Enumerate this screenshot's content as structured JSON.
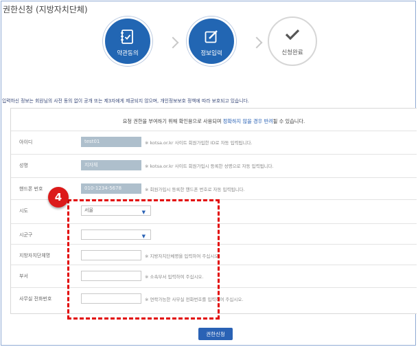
{
  "page": {
    "title": "권한신청 (지방자치단체)",
    "notice": "입력하신 정보는 회원님의 사전 동의 없이 공개 또는 제3자에게 제공되지 않으며, 개인정보보호 정책에 따라 보호되고 있습니다."
  },
  "steps": [
    {
      "label": "약관동의",
      "icon": "document-check-icon",
      "state": "active"
    },
    {
      "label": "정보입력",
      "icon": "edit-icon",
      "state": "active"
    },
    {
      "label": "신청완료",
      "icon": "check-icon",
      "state": "inactive"
    }
  ],
  "form": {
    "header": {
      "prefix": "요청 권한을 부여하기 위해 확인용으로 사용되며 ",
      "warning": "정확하지 않을 경우 반려",
      "suffix": "될 수 있습니다."
    },
    "id": {
      "label": "아이디",
      "value": "test01",
      "hint": "※ kotsa.or.kr 사이트 회원가입한 ID로 자동 입력됩니다."
    },
    "name": {
      "label": "성명",
      "value": "지자체",
      "hint": "※ kotsa.or.kr 사이트 회원가입시 등록한 성명으로 자동 입력됩니다."
    },
    "phone": {
      "label": "핸드폰 번호",
      "value": "010-1234-5678",
      "hint": "※ 회원가입시 등록한 핸드폰 번호로 자동 입력됩니다."
    },
    "sido": {
      "label": "시도",
      "value": "서울"
    },
    "sigungu": {
      "label": "시군구",
      "value": ""
    },
    "org": {
      "label": "지방자치단체명",
      "value": "",
      "hint": "※ 지방자치단체명을 입력하여 주십시오."
    },
    "dept": {
      "label": "부서",
      "value": "",
      "hint": "※ 소속부서 입력하여 주십시오."
    },
    "office_phone": {
      "label": "사무실 전화번호",
      "value": "",
      "hint": "※ 연락가능한 사무실 전화번호를 입력하여 주십시오."
    }
  },
  "annotation": {
    "step_number": "4",
    "color": "#e20000"
  },
  "submit": {
    "label": "권한신청"
  },
  "colors": {
    "primary": "#2266b3",
    "readonly": "#aebfcc",
    "highlight": "#e20000"
  }
}
